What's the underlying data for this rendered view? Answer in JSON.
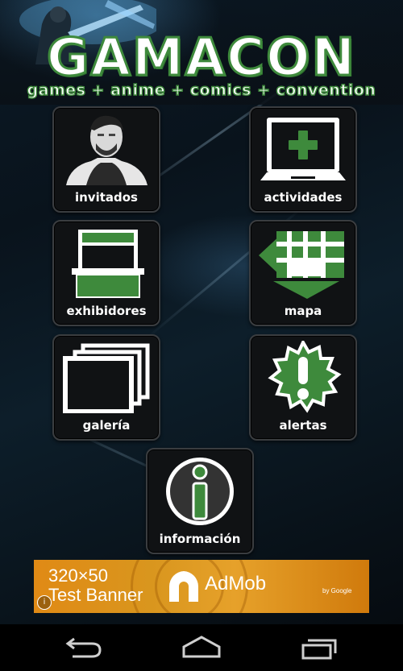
{
  "header": {
    "title": "GAMACON",
    "subtitle": "games + anime + comics + convention"
  },
  "menu": {
    "invitados": "invitados",
    "actividades": "actividades",
    "exhibidores": "exhibidores",
    "mapa": "mapa",
    "galeria": "galería",
    "alertas": "alertas",
    "informacion": "información"
  },
  "ad": {
    "size": "320×50",
    "label": "Test Banner",
    "brand": "AdMob",
    "by": "by Google",
    "info": "i"
  },
  "colors": {
    "accent": "#3e8a3c",
    "tile_bg": "#101214",
    "tile_border": "#3a3d40"
  },
  "navigation": {
    "back": "back-icon",
    "home": "home-icon",
    "recents": "recents-icon"
  }
}
